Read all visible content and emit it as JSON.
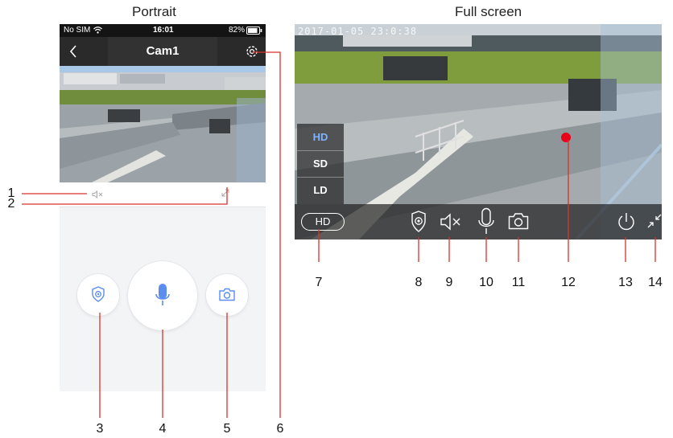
{
  "headings": {
    "portrait": "Portrait",
    "fullscreen": "Full screen"
  },
  "portrait": {
    "status": {
      "carrier": "No SIM",
      "time": "16:01",
      "battery": "82%"
    },
    "title": "Cam1",
    "icons": {
      "back": "chevron-left-icon",
      "settings": "gear-icon",
      "mute": "speaker-mute-icon",
      "expand": "expand-icon",
      "alarm": "shield-icon",
      "mic": "microphone-icon",
      "camera": "camera-icon"
    }
  },
  "fullscreen": {
    "timestamp": "2017-01-05 23:0:38",
    "quality_options": [
      "HD",
      "SD",
      "LD"
    ],
    "quality_selected": "HD",
    "hd_button": "HD",
    "icons": {
      "alarm": "shield-icon",
      "mute": "speaker-mute-icon",
      "mic": "microphone-icon",
      "snapshot": "camera-icon",
      "power": "power-icon",
      "exit_fullscreen": "collapse-icon"
    }
  },
  "callouts": [
    "1",
    "2",
    "3",
    "4",
    "5",
    "6",
    "7",
    "8",
    "9",
    "10",
    "11",
    "12",
    "13",
    "14"
  ],
  "colors": {
    "accent_blue": "#5b8def",
    "callout_red": "#d9322b",
    "focus_dot": "#e8001b"
  }
}
